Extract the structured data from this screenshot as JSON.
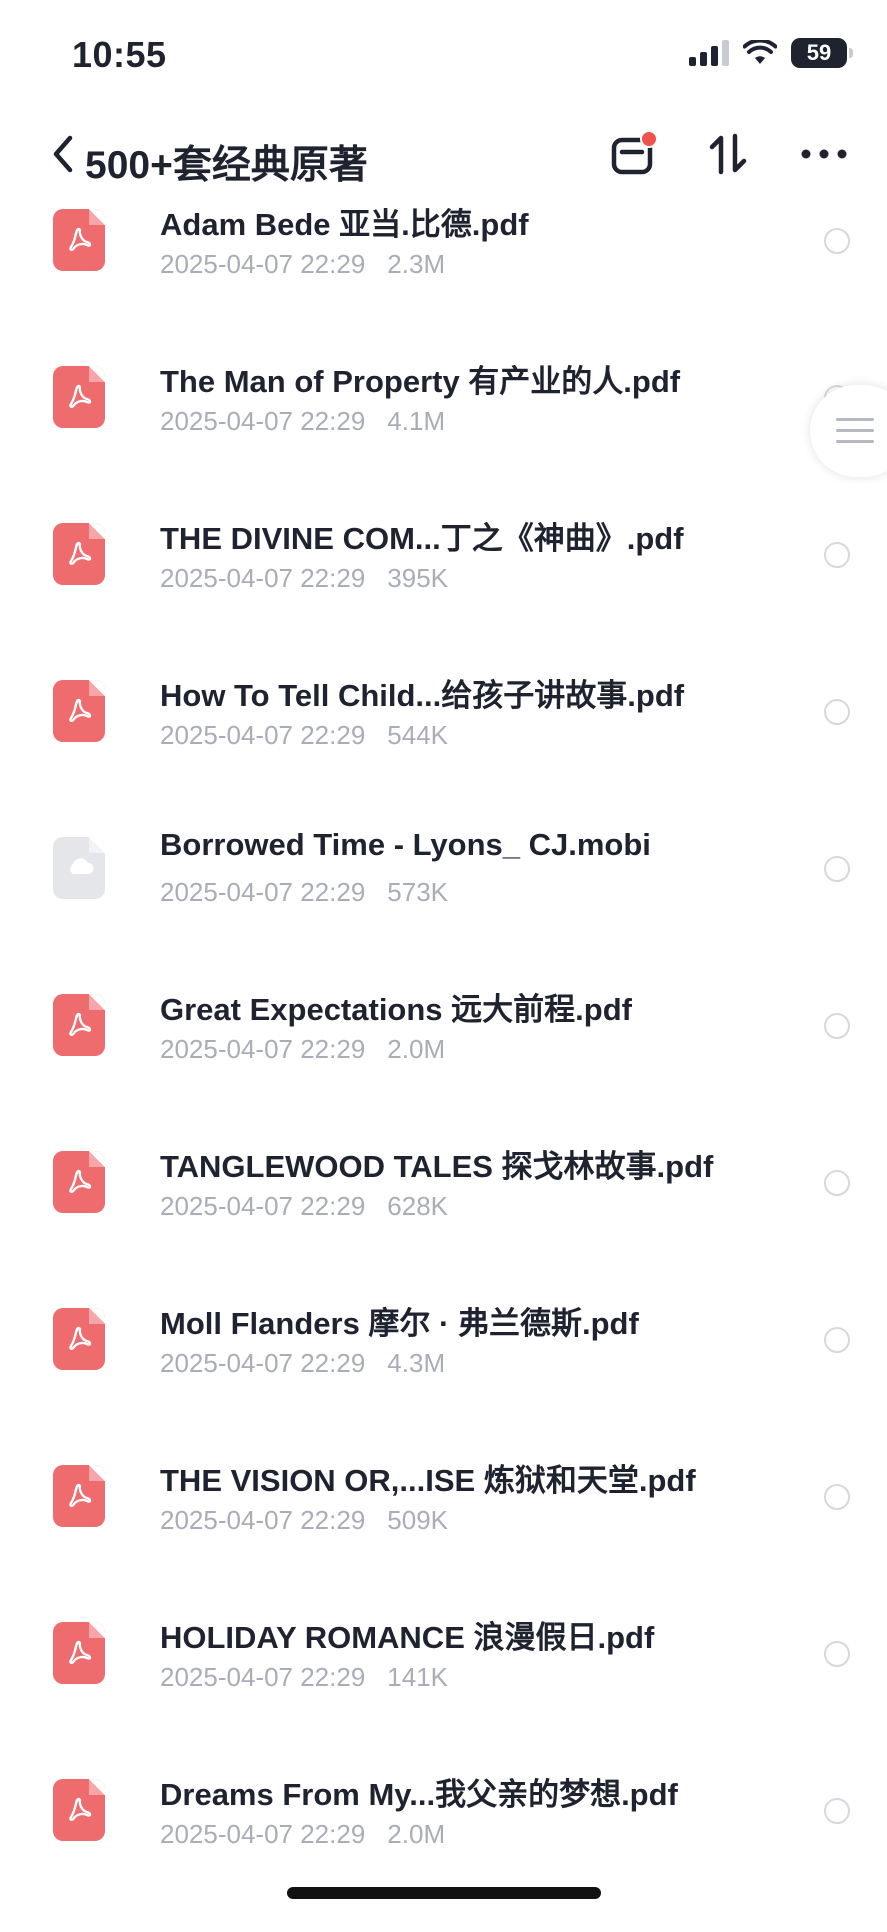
{
  "status_bar": {
    "time": "10:55",
    "battery": "59"
  },
  "header": {
    "title": "500+套经典原著"
  },
  "files": [
    {
      "name": "Adam Bede 亚当.比德.pdf",
      "date": "2025-04-07 22:29",
      "size": "2.3M",
      "type": "pdf"
    },
    {
      "name": "The Man of Property 有产业的人.pdf",
      "date": "2025-04-07 22:29",
      "size": "4.1M",
      "type": "pdf"
    },
    {
      "name": "THE DIVINE COM...丁之《神曲》.pdf",
      "date": "2025-04-07 22:29",
      "size": "395K",
      "type": "pdf"
    },
    {
      "name": "How To Tell Child...给孩子讲故事.pdf",
      "date": "2025-04-07 22:29",
      "size": "544K",
      "type": "pdf"
    },
    {
      "name": "Borrowed Time - Lyons_ CJ.mobi",
      "date": "2025-04-07 22:29",
      "size": "573K",
      "type": "cloud"
    },
    {
      "name": "Great Expectations 远大前程.pdf",
      "date": "2025-04-07 22:29",
      "size": "2.0M",
      "type": "pdf"
    },
    {
      "name": "TANGLEWOOD TALES 探戈林故事.pdf",
      "date": "2025-04-07 22:29",
      "size": "628K",
      "type": "pdf"
    },
    {
      "name": "Moll Flanders 摩尔 · 弗兰德斯.pdf",
      "date": "2025-04-07 22:29",
      "size": "4.3M",
      "type": "pdf"
    },
    {
      "name": "THE VISION OR,...ISE 炼狱和天堂.pdf",
      "date": "2025-04-07 22:29",
      "size": "509K",
      "type": "pdf"
    },
    {
      "name": "HOLIDAY ROMANCE 浪漫假日.pdf",
      "date": "2025-04-07 22:29",
      "size": "141K",
      "type": "pdf"
    },
    {
      "name": "Dreams From My...我父亲的梦想.pdf",
      "date": "2025-04-07 22:29",
      "size": "2.0M",
      "type": "pdf"
    }
  ]
}
